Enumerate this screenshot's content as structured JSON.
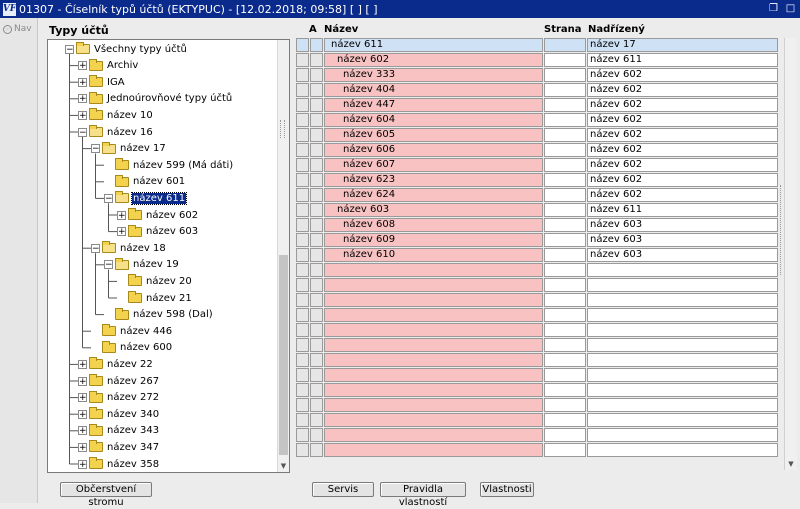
{
  "window": {
    "title": "01307 - Číselník typů účtů (EKTYPUC) - [12.02.2018; 09:58]  [ ]  [ ]",
    "app_icon": "VF"
  },
  "nav_tab": {
    "label": "Nav",
    "icon": "nav-icon"
  },
  "tree": {
    "label": "Typy účtů",
    "nodes": [
      {
        "label": "Všechny typy účtů",
        "depth": 0,
        "state": "open"
      },
      {
        "label": "Archiv",
        "depth": 1,
        "state": "closed"
      },
      {
        "label": "IGA",
        "depth": 1,
        "state": "closed"
      },
      {
        "label": "Jednoúrovňové typy účtů",
        "depth": 1,
        "state": "closed"
      },
      {
        "label": "název 10",
        "depth": 1,
        "state": "closed"
      },
      {
        "label": "název 16",
        "depth": 1,
        "state": "open"
      },
      {
        "label": "název 17",
        "depth": 2,
        "state": "open"
      },
      {
        "label": "název 599 (Má dáti)",
        "depth": 3,
        "state": "leaf"
      },
      {
        "label": "název 601",
        "depth": 3,
        "state": "leaf"
      },
      {
        "label": "název 611",
        "depth": 3,
        "state": "open",
        "selected": true
      },
      {
        "label": "název 602",
        "depth": 4,
        "state": "closed"
      },
      {
        "label": "název 603",
        "depth": 4,
        "state": "closed"
      },
      {
        "label": "název 18",
        "depth": 2,
        "state": "open"
      },
      {
        "label": "název 19",
        "depth": 3,
        "state": "open"
      },
      {
        "label": "název 20",
        "depth": 4,
        "state": "leaf"
      },
      {
        "label": "název 21",
        "depth": 4,
        "state": "leaf"
      },
      {
        "label": "název 598 (Dal)",
        "depth": 3,
        "state": "leaf"
      },
      {
        "label": "název 446",
        "depth": 2,
        "state": "leaf"
      },
      {
        "label": "název 600",
        "depth": 2,
        "state": "leaf"
      },
      {
        "label": "název 22",
        "depth": 1,
        "state": "closed"
      },
      {
        "label": "název 267",
        "depth": 1,
        "state": "closed"
      },
      {
        "label": "název 272",
        "depth": 1,
        "state": "closed"
      },
      {
        "label": "název 340",
        "depth": 1,
        "state": "closed"
      },
      {
        "label": "název 343",
        "depth": 1,
        "state": "closed"
      },
      {
        "label": "název 347",
        "depth": 1,
        "state": "closed"
      },
      {
        "label": "název 358",
        "depth": 1,
        "state": "closed"
      }
    ]
  },
  "grid": {
    "columns": {
      "a": "A",
      "name": "Název",
      "strana": "Strana",
      "parent": "Nadřízený"
    },
    "rows": [
      {
        "name": "název 611",
        "indent": 1,
        "strana": "",
        "parent": "název 17",
        "active": true
      },
      {
        "name": "název 602",
        "indent": 2,
        "strana": "",
        "parent": "název 611"
      },
      {
        "name": "název 333",
        "indent": 3,
        "strana": "",
        "parent": "název 602"
      },
      {
        "name": "název 404",
        "indent": 3,
        "strana": "",
        "parent": "název 602"
      },
      {
        "name": "název 447",
        "indent": 3,
        "strana": "",
        "parent": "název 602"
      },
      {
        "name": "název 604",
        "indent": 3,
        "strana": "",
        "parent": "název 602"
      },
      {
        "name": "název 605",
        "indent": 3,
        "strana": "",
        "parent": "název 602"
      },
      {
        "name": "název 606",
        "indent": 3,
        "strana": "",
        "parent": "název 602"
      },
      {
        "name": "název 607",
        "indent": 3,
        "strana": "",
        "parent": "název 602"
      },
      {
        "name": "název 623",
        "indent": 3,
        "strana": "",
        "parent": "název 602"
      },
      {
        "name": "název 624",
        "indent": 3,
        "strana": "",
        "parent": "název 602"
      },
      {
        "name": "název 603",
        "indent": 2,
        "strana": "",
        "parent": "název 611"
      },
      {
        "name": "název 608",
        "indent": 3,
        "strana": "",
        "parent": "název 603"
      },
      {
        "name": "název 609",
        "indent": 3,
        "strana": "",
        "parent": "název 603"
      },
      {
        "name": "název 610",
        "indent": 3,
        "strana": "",
        "parent": "název 603"
      }
    ],
    "empty_rows": 13
  },
  "buttons": {
    "refresh_tree": "Občerstvení stromu",
    "servis": "Servis",
    "rules": "Pravidla vlastností",
    "properties": "Vlastnosti"
  },
  "colors": {
    "title_bar": "#0a2a8c",
    "name_cell": "#f9c2c2",
    "active_row": "#cfe1f5",
    "folder": "#f3d24d"
  }
}
